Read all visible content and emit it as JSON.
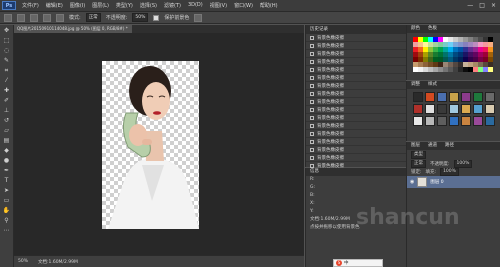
{
  "app": {
    "logo": "Ps"
  },
  "menu": [
    "文件(F)",
    "编辑(E)",
    "图像(I)",
    "图层(L)",
    "类型(Y)",
    "选择(S)",
    "滤镜(T)",
    "3D(D)",
    "视图(V)",
    "窗口(W)",
    "帮助(H)"
  ],
  "window_controls": [
    "—",
    "□",
    "×"
  ],
  "options": {
    "mode_label": "模式:",
    "mode_value": "正常",
    "opacity_label": "不透明度:",
    "opacity_value": "50%",
    "protect_label": "保护前景色"
  },
  "document": {
    "tab_title": "QQ图片20150910114048.jpg @ 50% (图层 0, RGB/8#) *"
  },
  "status": {
    "zoom": "50%",
    "doc_size": "文档:1.60M/2.99M"
  },
  "history": {
    "title": "历史记录",
    "item_label": "背景色橡皮擦",
    "items": [
      "背景色橡皮擦",
      "背景色橡皮擦",
      "背景色橡皮擦",
      "背景色橡皮擦",
      "背景色橡皮擦",
      "背景色橡皮擦",
      "背景色橡皮擦",
      "背景色橡皮擦",
      "背景色橡皮擦",
      "背景色橡皮擦",
      "背景色橡皮擦",
      "背景色橡皮擦",
      "背景色橡皮擦",
      "背景色橡皮擦",
      "背景色橡皮擦",
      "背景色橡皮擦",
      "背景色橡皮擦",
      "背景色橡皮擦",
      "背景色橡皮擦"
    ]
  },
  "info": {
    "title": "信息",
    "lines": [
      "R:",
      "G:",
      "B:",
      "X:",
      "Y:",
      "文档:1.60M/2.99M",
      "点按并拖移以使用背景色"
    ]
  },
  "swatches": {
    "tabs": [
      "颜色",
      "色板"
    ],
    "colors": [
      "#ff0000",
      "#ffff00",
      "#00ff00",
      "#00ffff",
      "#0000ff",
      "#ff00ff",
      "#ffffff",
      "#e6e6e6",
      "#cccccc",
      "#b3b3b3",
      "#999999",
      "#808080",
      "#666666",
      "#4d4d4d",
      "#333333",
      "#000000",
      "#f0a0a0",
      "#f4c48c",
      "#fff799",
      "#c6df9c",
      "#a2d39c",
      "#82ca9c",
      "#7accc8",
      "#6dcff6",
      "#7da7d9",
      "#8393ca",
      "#8781bd",
      "#a186be",
      "#bd8cbf",
      "#f49ac1",
      "#f5989d",
      "#f9ad81",
      "#ed1c24",
      "#f26522",
      "#fff200",
      "#8dc63f",
      "#39b54a",
      "#00a651",
      "#00a99d",
      "#00aeef",
      "#0072bc",
      "#0054a6",
      "#2e3192",
      "#662d91",
      "#92278f",
      "#ec008c",
      "#ed145b",
      "#f7941d",
      "#9e0b0f",
      "#a0410d",
      "#aba000",
      "#598527",
      "#197b30",
      "#007236",
      "#00746b",
      "#0076a3",
      "#004a80",
      "#003471",
      "#1b1464",
      "#440e62",
      "#630460",
      "#9e005d",
      "#9e0039",
      "#a36209",
      "#790000",
      "#7b2e00",
      "#827b00",
      "#406618",
      "#005e20",
      "#005826",
      "#005952",
      "#005b7f",
      "#003663",
      "#002157",
      "#0d004c",
      "#32004b",
      "#4b0049",
      "#7b0046",
      "#7a0026",
      "#7d4900",
      "#c69c6d",
      "#a67c52",
      "#8c6239",
      "#754c24",
      "#603913",
      "#3c2415",
      "#998675",
      "#736357",
      "#534741",
      "#362f2d",
      "#c7b299",
      "#bfa17f",
      "#a68a64",
      "#7b6b54",
      "#594a3c",
      "#3a2e25",
      "#ffffff",
      "#f2f2f2",
      "#d9d9d9",
      "#bfbfbf",
      "#a6a6a6",
      "#8c8c8c",
      "#737373",
      "#595959",
      "#404040",
      "#262626",
      "#0d0d0d",
      "#000000",
      "#ff8080",
      "#80ff80",
      "#8080ff",
      "#ffff80"
    ]
  },
  "styles": {
    "tabs": [
      "调整",
      "样式"
    ],
    "tiles": [
      "#2a2a2a",
      "#d34a20",
      "#4a6fb0",
      "#c7a24a",
      "#8c3b8c",
      "#1e7a3c",
      "#6a6a6a",
      "#b0302a",
      "#e0e0e0",
      "#3a3a3a",
      "#a0c8e0",
      "#dcaa50",
      "#55a0d0",
      "#d9cbb0",
      "#e8e8e8",
      "#b8b8b8",
      "#5e5e5e",
      "#3070c0",
      "#ca8440",
      "#9a4a9a",
      "#2a6aa0"
    ]
  },
  "layers": {
    "tabs": [
      "图层",
      "通道",
      "路径"
    ],
    "kind_label": "类型",
    "blend_mode": "正常",
    "opacity_label": "不透明度:",
    "opacity_value": "100%",
    "lock_label": "锁定:",
    "fill_label": "填充:",
    "fill_value": "100%",
    "layer_name": "图层 0"
  },
  "watermark": "shancun",
  "ime": {
    "label": "中"
  }
}
